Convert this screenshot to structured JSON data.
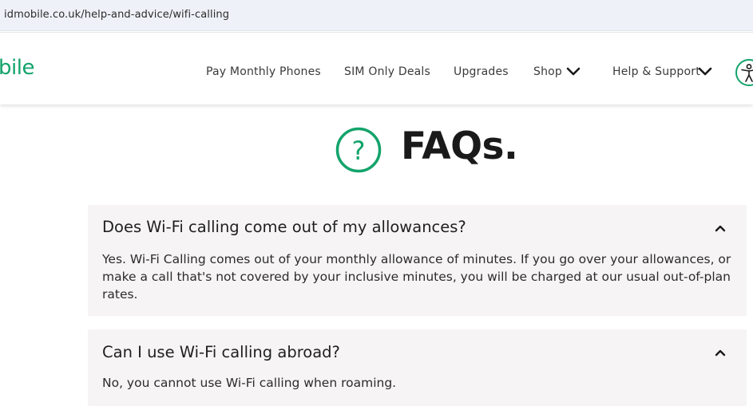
{
  "browser": {
    "url": "idmobile.co.uk/help-and-advice/wifi-calling"
  },
  "header": {
    "logo_text": "bile",
    "nav": [
      {
        "label": "Pay Monthly Phones"
      },
      {
        "label": "SIM Only Deals"
      },
      {
        "label": "Upgrades"
      },
      {
        "label": "Shop"
      },
      {
        "label": "Help & Support"
      }
    ],
    "accessibility_icon": "accessibility-icon"
  },
  "faqs": {
    "title": "FAQs.",
    "icon": "question-circle-icon",
    "items": [
      {
        "question": "Does Wi-Fi calling come out of my allowances?",
        "answer_lines": [
          "Yes. Wi-Fi Calling comes out of your monthly allowance of minutes. If you go over your allowances, or",
          "make a call that's not covered by your inclusive minutes, you will be charged at our usual out-of-plan",
          "rates."
        ],
        "expanded": true
      },
      {
        "question": "Can I use Wi-Fi calling abroad?",
        "answer_lines": [
          "No, you cannot use Wi-Fi calling when roaming."
        ],
        "expanded": true
      }
    ]
  },
  "colors": {
    "brand_green": "#13a36b",
    "card_bg": "#f6f4f4",
    "url_bar_bg": "#eef1f8"
  }
}
